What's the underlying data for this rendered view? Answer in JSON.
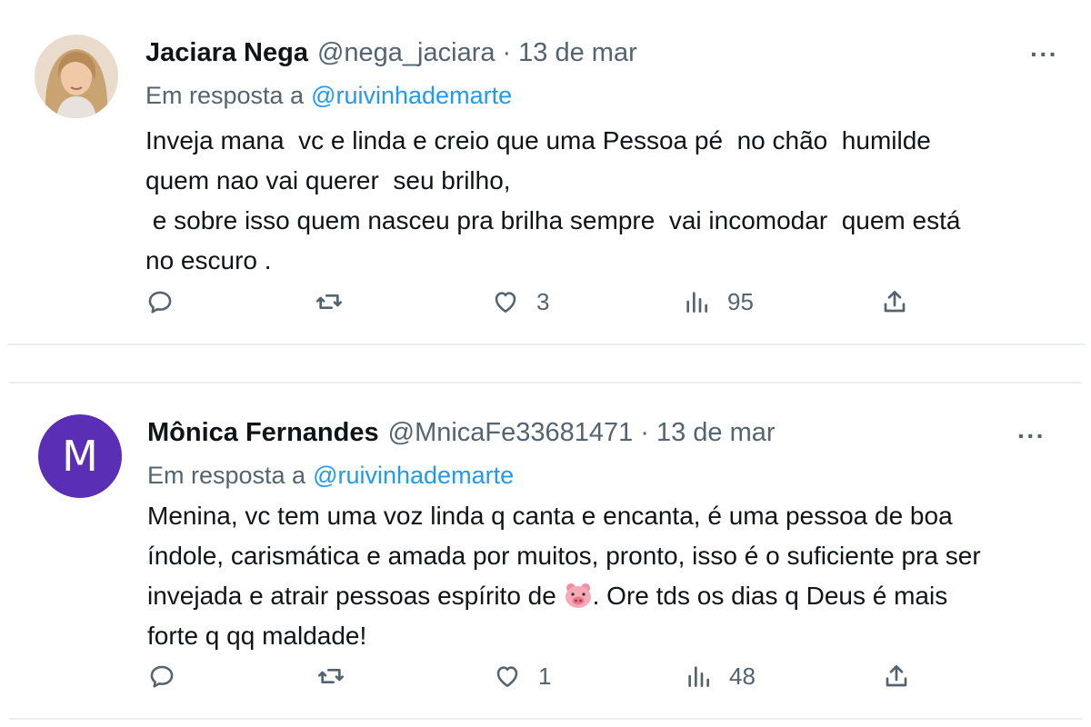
{
  "tweets": [
    {
      "name": "Jaciara Nega",
      "handle": "@nega_jaciara",
      "separator": "·",
      "date": "13 de mar",
      "reply_prefix": "Em resposta a",
      "reply_handle": "@ruivinhademarte",
      "text": "Inveja mana  vc e linda e creio que uma Pessoa pé  no chão  humilde\nquem nao vai querer  seu brilho,\n e sobre isso quem nasceu pra brilha sempre  vai incomodar  quem está\nno escuro .",
      "likes": "3",
      "views": "95",
      "avatar_icon": "photo-avatar-icon"
    },
    {
      "name": "Mônica Fernandes",
      "handle": "@MnicaFe33681471",
      "separator": "·",
      "date": "13 de mar",
      "reply_prefix": "Em resposta a",
      "reply_handle": "@ruivinhademarte",
      "text_part1": "Menina, vc tem uma voz linda q canta e encanta, é uma pessoa de boa\níndole, carismática e amada por muitos, pronto, isso é o suficiente pra ser\ninvejada e atrair pessoas espírito de ",
      "text_emoji": "pig-face-emoji",
      "text_part2": ". Ore tds os dias q Deus é mais\nforte q qq maldade!",
      "likes": "1",
      "views": "48",
      "avatar_letter": "M",
      "avatar_color": "#5b2fb5"
    }
  ],
  "more_label": "···",
  "colors": {
    "link": "#1d9bf0",
    "muted": "#536471",
    "text": "#0f1419"
  }
}
